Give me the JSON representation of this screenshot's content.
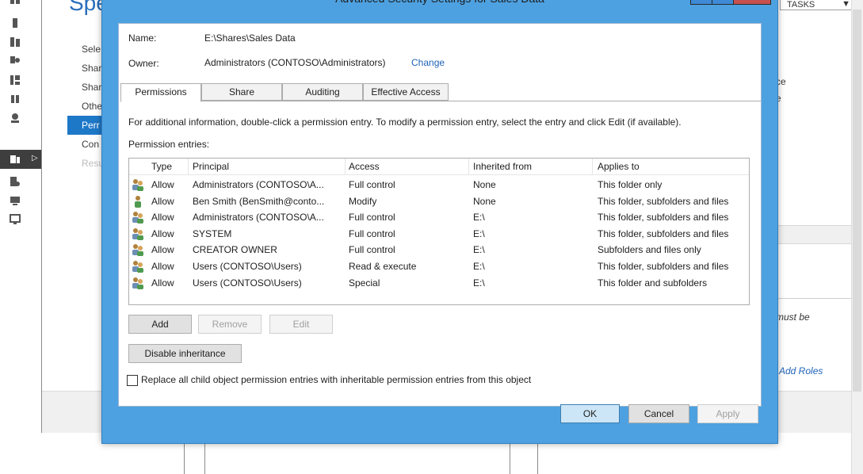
{
  "wizard": {
    "title": "Spec",
    "nav": [
      "Sele",
      "Shar",
      "Shar",
      "Othe",
      "Perr",
      "Con",
      "Resu"
    ],
    "active_index": 4,
    "tasks_label": "TASKS",
    "right_panel": {
      "line1": "ce",
      "line2": "e",
      "must_be": "must be",
      "add_roles": "Add Roles"
    }
  },
  "dialog": {
    "title": "Advanced Security Settings for Sales Data",
    "name_label": "Name:",
    "name_value": "E:\\Shares\\Sales Data",
    "owner_label": "Owner:",
    "owner_value": "Administrators (CONTOSO\\Administrators)",
    "change_link": "Change",
    "tabs": [
      "Permissions",
      "Share",
      "Auditing",
      "Effective Access"
    ],
    "active_tab": 0,
    "info_text": "For additional information, double-click a permission entry. To modify a permission entry, select the entry and click Edit (if available).",
    "entries_label": "Permission entries:",
    "columns": [
      "Type",
      "Principal",
      "Access",
      "Inherited from",
      "Applies to"
    ],
    "rows": [
      {
        "type": "Allow",
        "principal": "Administrators (CONTOSO\\A...",
        "access": "Full control",
        "inherited": "None",
        "applies": "This folder only",
        "icon": "group-icon"
      },
      {
        "type": "Allow",
        "principal": "Ben Smith (BenSmith@conto...",
        "access": "Modify",
        "inherited": "None",
        "applies": "This folder, subfolders and files",
        "icon": "user-icon"
      },
      {
        "type": "Allow",
        "principal": "Administrators (CONTOSO\\A...",
        "access": "Full control",
        "inherited": "E:\\",
        "applies": "This folder, subfolders and files",
        "icon": "group-icon"
      },
      {
        "type": "Allow",
        "principal": "SYSTEM",
        "access": "Full control",
        "inherited": "E:\\",
        "applies": "This folder, subfolders and files",
        "icon": "group-icon"
      },
      {
        "type": "Allow",
        "principal": "CREATOR OWNER",
        "access": "Full control",
        "inherited": "E:\\",
        "applies": "Subfolders and files only",
        "icon": "group-icon"
      },
      {
        "type": "Allow",
        "principal": "Users (CONTOSO\\Users)",
        "access": "Read & execute",
        "inherited": "E:\\",
        "applies": "This folder, subfolders and files",
        "icon": "group-icon"
      },
      {
        "type": "Allow",
        "principal": "Users (CONTOSO\\Users)",
        "access": "Special",
        "inherited": "E:\\",
        "applies": "This folder and subfolders",
        "icon": "group-icon"
      }
    ],
    "buttons": {
      "add": "Add",
      "remove": "Remove",
      "edit": "Edit",
      "disable_inheritance": "Disable inheritance",
      "ok": "OK",
      "cancel": "Cancel",
      "apply": "Apply"
    },
    "replace_checkbox_label": "Replace all child object permission entries with inheritable permission entries from this object",
    "replace_checked": false
  },
  "colors": {
    "title_bar": "#4ea1e0",
    "accent": "#1e78c8",
    "link": "#1e62b8"
  }
}
